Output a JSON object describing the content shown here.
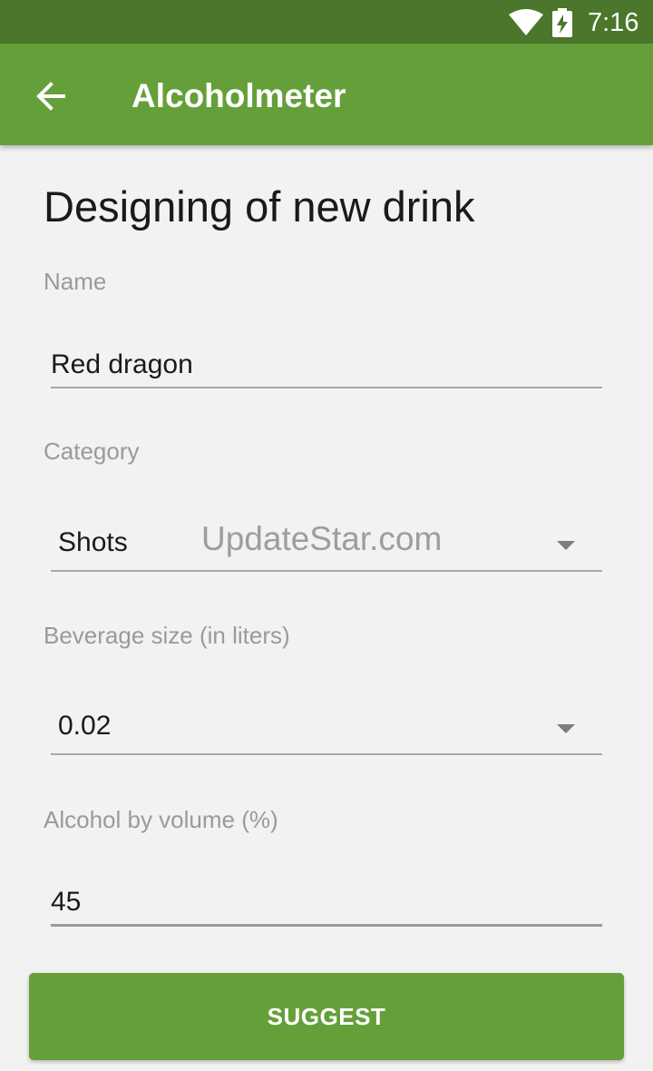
{
  "status_bar": {
    "time": "7:16",
    "wifi_icon": "wifi-icon",
    "battery_icon": "battery-charging-icon"
  },
  "app_bar": {
    "back_icon": "arrow-back-icon",
    "title": "Alcoholmeter"
  },
  "form": {
    "heading": "Designing of new drink",
    "name": {
      "label": "Name",
      "value": "Red dragon"
    },
    "category": {
      "label": "Category",
      "value": "Shots"
    },
    "beverage_size": {
      "label": "Beverage size (in liters)",
      "value": "0.02"
    },
    "abv": {
      "label": "Alcohol by volume (%)",
      "value": "45"
    },
    "submit_label": "SUGGEST"
  },
  "watermark": "UpdateStar.com",
  "colors": {
    "status_bar": "#4b762b",
    "app_bar": "#659f39",
    "button": "#659f39",
    "background": "#f2f2f2"
  }
}
